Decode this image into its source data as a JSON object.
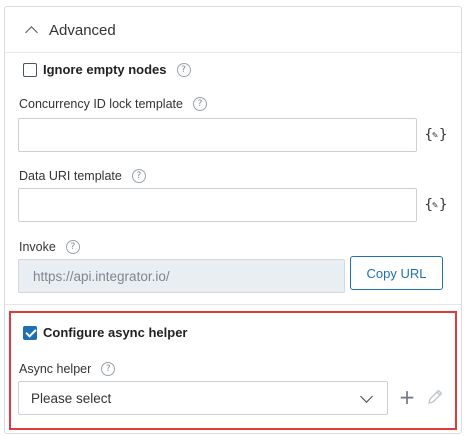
{
  "panel": {
    "title": "Advanced"
  },
  "ignore_empty_nodes": {
    "label": "Ignore empty nodes",
    "checked": false
  },
  "concurrency_lock": {
    "label": "Concurrency ID lock template",
    "value": ""
  },
  "data_uri": {
    "label": "Data URI template",
    "value": ""
  },
  "invoke": {
    "label": "Invoke",
    "value": "https://api.integrator.io/",
    "copy_label": "Copy URL"
  },
  "async_helper_toggle": {
    "label": "Configure async helper",
    "checked": true
  },
  "async_helper": {
    "label": "Async helper",
    "selected": "Please select"
  },
  "help_glyph": "?",
  "colors": {
    "accent": "#1f6fb5",
    "highlight": "#e0393e",
    "border": "#c9d0d6",
    "readonly_bg": "#e9eef2"
  },
  "icons": {
    "collapse": "chevron-up-icon",
    "help": "help-icon",
    "handlebars_editor": "braces-pencil-icon",
    "dropdown": "chevron-down-icon",
    "add": "plus-icon",
    "edit": "pencil-icon"
  }
}
